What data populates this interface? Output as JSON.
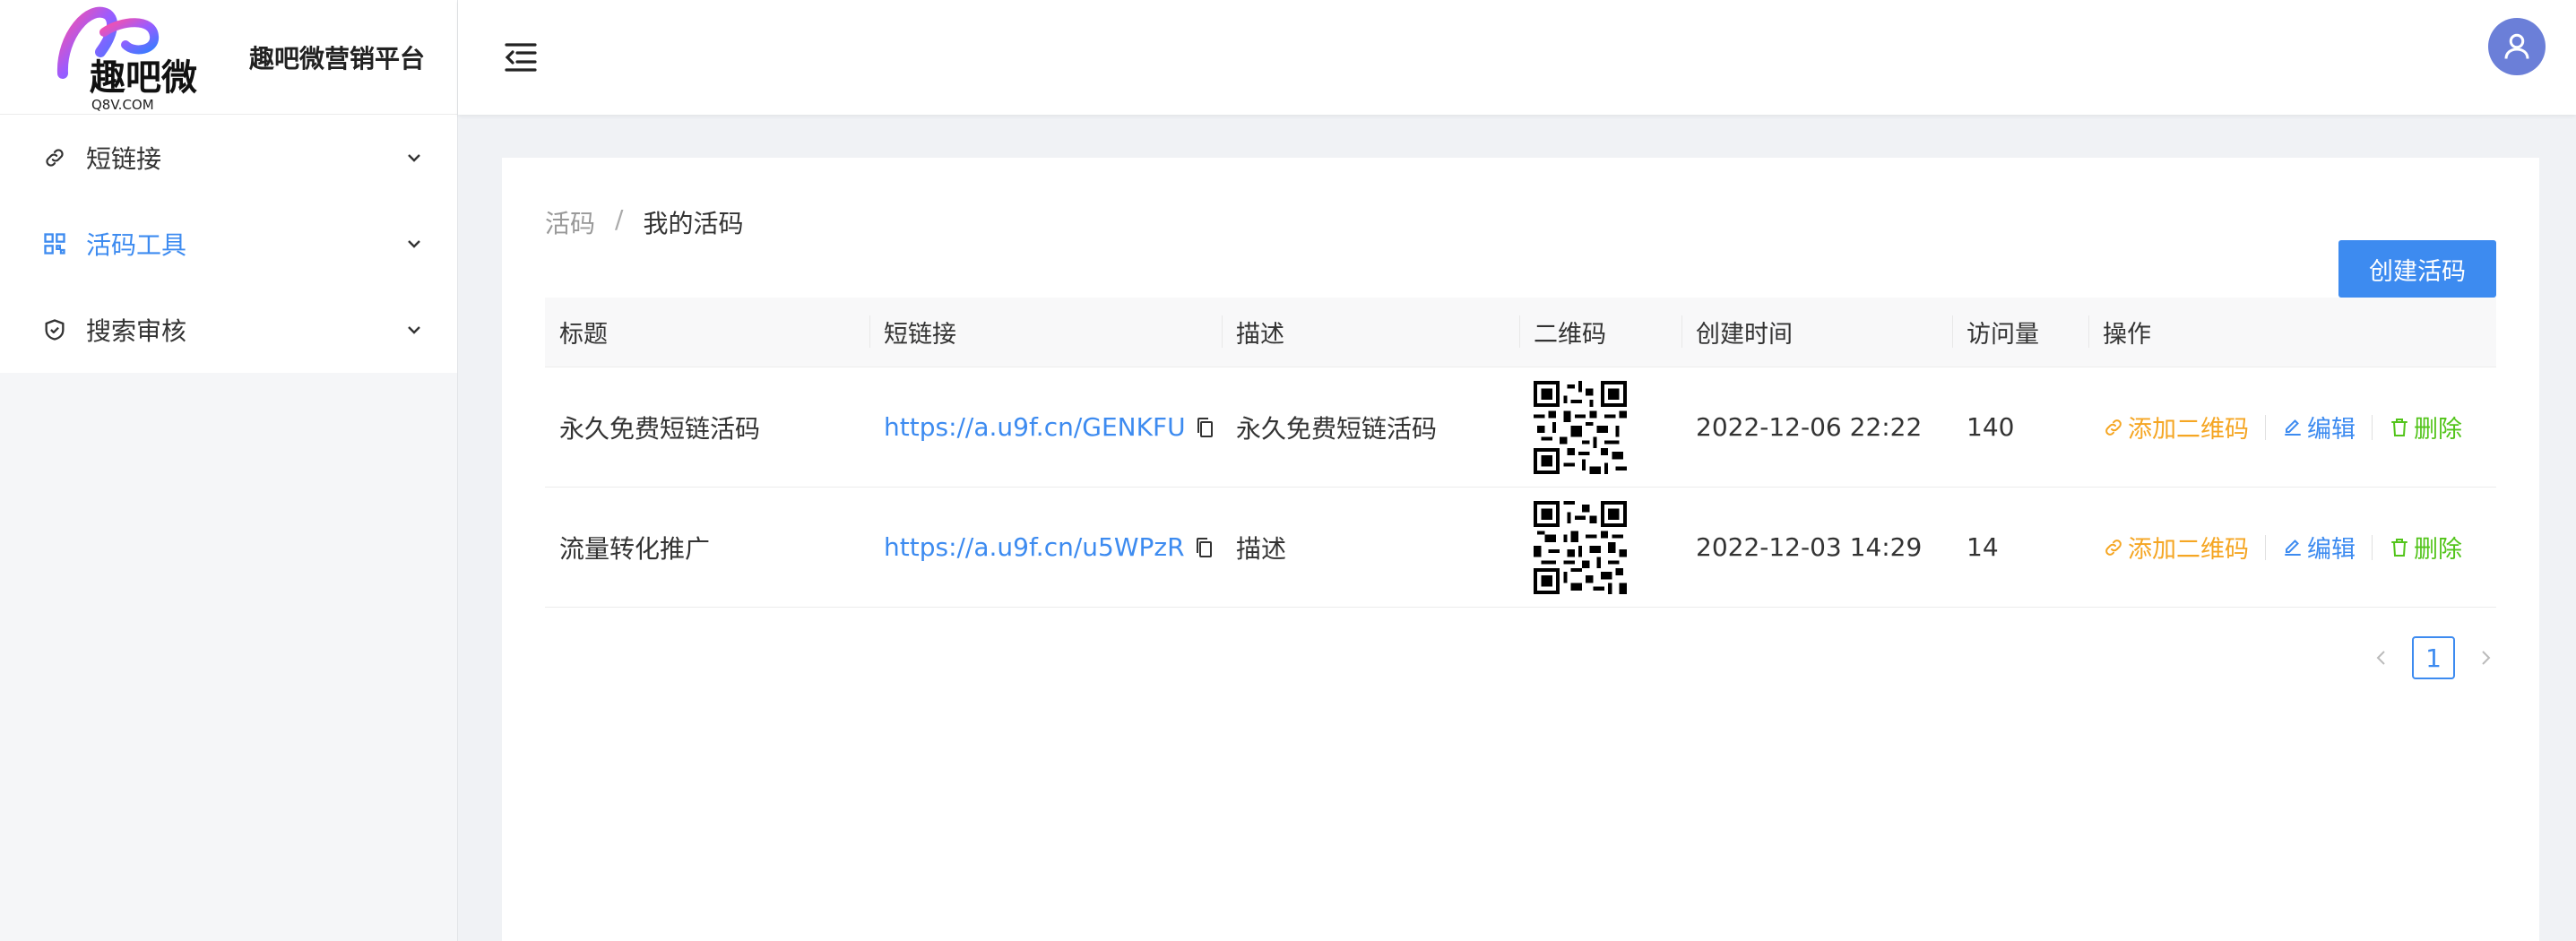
{
  "brand": {
    "logo_text": "趣吧微",
    "logo_sub": "Q8V.COM",
    "title": "趣吧微营销平台"
  },
  "sidebar": {
    "items": [
      {
        "label": "短链接",
        "icon": "link-icon"
      },
      {
        "label": "活码工具",
        "icon": "qrcode-icon",
        "active": true
      },
      {
        "label": "搜索审核",
        "icon": "shield-icon"
      }
    ]
  },
  "breadcrumb": {
    "parent": "活码",
    "separator": "/",
    "current": "我的活码"
  },
  "toolbar": {
    "create_label": "创建活码"
  },
  "table": {
    "columns": [
      "标题",
      "短链接",
      "描述",
      "二维码",
      "创建时间",
      "访问量",
      "操作"
    ],
    "rows": [
      {
        "title": "永久免费短链活码",
        "short_link": "https://a.u9f.cn/GENKFU",
        "description": "永久免费短链活码",
        "created": "2022-12-06 22:22",
        "visits": "140"
      },
      {
        "title": "流量转化推广",
        "short_link": "https://a.u9f.cn/u5WPzR",
        "description": "描述",
        "created": "2022-12-03 14:29",
        "visits": "14"
      }
    ],
    "actions": {
      "add_qr": "添加二维码",
      "edit": "编辑",
      "delete": "删除"
    }
  },
  "pagination": {
    "current_page": "1"
  },
  "colors": {
    "primary": "#3d8bf0",
    "orange": "#f5a623",
    "green": "#52c41a",
    "avatar": "#6b7fd8"
  }
}
